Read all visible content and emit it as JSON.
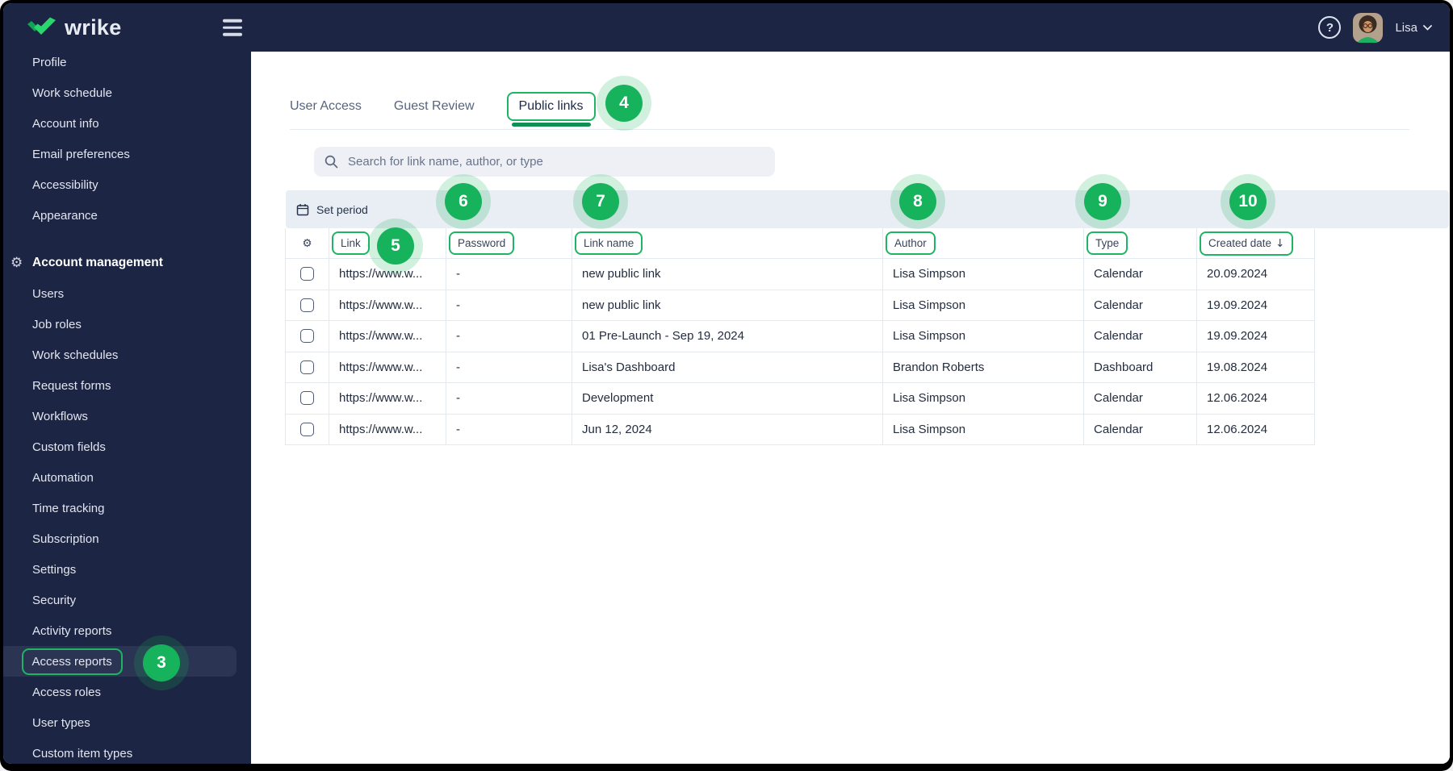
{
  "topbar": {
    "logo_text": "wrike",
    "help_glyph": "?",
    "user_name": "Lisa"
  },
  "sidebar": {
    "top_items": [
      "Profile",
      "Work schedule",
      "Account info",
      "Email preferences",
      "Accessibility",
      "Appearance"
    ],
    "section_label": "Account management",
    "section_items": [
      "Users",
      "Job roles",
      "Work schedules",
      "Request forms",
      "Workflows",
      "Custom fields",
      "Automation",
      "Time tracking",
      "Subscription",
      "Settings",
      "Security",
      "Activity reports",
      "Access reports",
      "Access roles",
      "User types",
      "Custom item types"
    ],
    "active_item": "Access reports"
  },
  "tabs": [
    {
      "label": "User Access",
      "active": false
    },
    {
      "label": "Guest Review",
      "active": false
    },
    {
      "label": "Public links",
      "active": true
    }
  ],
  "search": {
    "placeholder": "Search for link name, author, or type"
  },
  "toolbar": {
    "set_period_label": "Set period"
  },
  "table": {
    "columns": [
      {
        "label": "Link"
      },
      {
        "label": "Password"
      },
      {
        "label": "Link name"
      },
      {
        "label": "Author"
      },
      {
        "label": "Type"
      },
      {
        "label": "Created date",
        "sort_arrow": "↓"
      }
    ],
    "rows": [
      {
        "link": "https://www.w...",
        "password": "-",
        "link_name": "new public link",
        "author": "Lisa Simpson",
        "type": "Calendar",
        "created": "20.09.2024"
      },
      {
        "link": "https://www.w...",
        "password": "-",
        "link_name": "new public link",
        "author": "Lisa Simpson",
        "type": "Calendar",
        "created": "19.09.2024"
      },
      {
        "link": "https://www.w...",
        "password": "-",
        "link_name": "01 Pre-Launch - Sep 19, 2024",
        "author": "Lisa Simpson",
        "type": "Calendar",
        "created": "19.09.2024"
      },
      {
        "link": "https://www.w...",
        "password": "-",
        "link_name": "Lisa's Dashboard",
        "author": "Brandon Roberts",
        "type": "Dashboard",
        "created": "19.08.2024"
      },
      {
        "link": "https://www.w...",
        "password": "-",
        "link_name": "Development",
        "author": "Lisa Simpson",
        "type": "Calendar",
        "created": "12.06.2024"
      },
      {
        "link": "https://www.w...",
        "password": "-",
        "link_name": "Jun 12, 2024",
        "author": "Lisa Simpson",
        "type": "Calendar",
        "created": "12.06.2024"
      }
    ]
  },
  "annotation_badges": [
    "3",
    "4",
    "5",
    "6",
    "7",
    "8",
    "9",
    "10"
  ],
  "colors": {
    "accent_green": "#17b25c",
    "green_outline": "#1fb463",
    "active_tab_underline": "#0f8f55",
    "navbar_navy": "#1c2543",
    "sidebar_active_row": "#2b3453",
    "toolbar_bg": "#e9edf4",
    "table_border": "#e4e8ef"
  }
}
